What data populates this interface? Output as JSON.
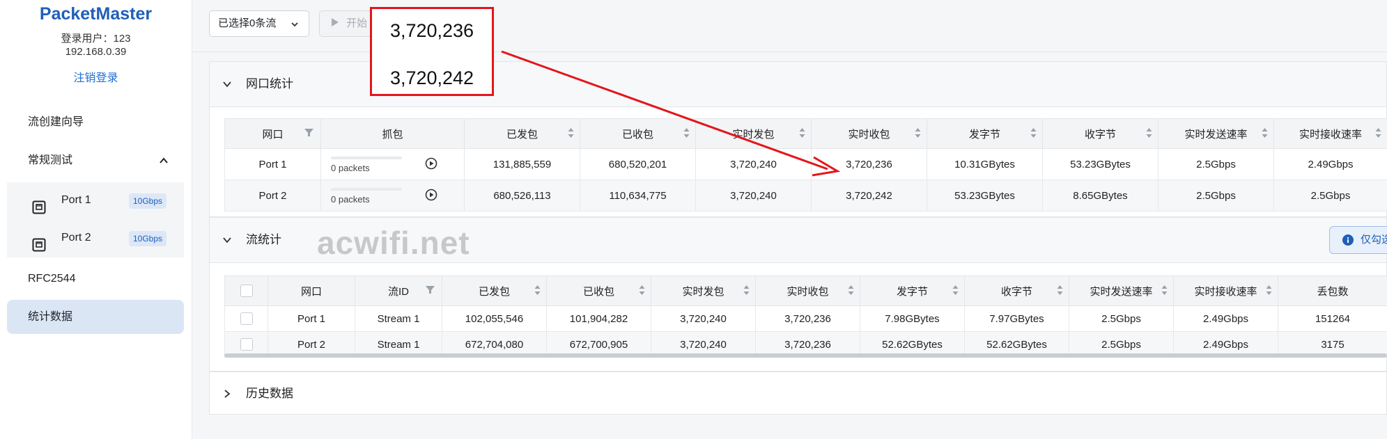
{
  "sidebar": {
    "brand": "PacketMaster",
    "login_user": "登录用户：123",
    "login_ip": "192.168.0.39",
    "logout": "注销登录",
    "nav": {
      "wizard": "流创建向导",
      "regular_test": "常规测试",
      "rfc": "RFC2544",
      "stats": "统计数据"
    },
    "ports": [
      {
        "label": "Port 1",
        "speed": "10Gbps"
      },
      {
        "label": "Port 2",
        "speed": "10Gbps"
      }
    ],
    "group_arrow": "^"
  },
  "toolbar": {
    "selected_flows": "已选择0条流",
    "start_label": "开始"
  },
  "annotation": {
    "value_top": "3,720,236",
    "value_bottom": "3,720,242",
    "color": "#e3161b"
  },
  "port_stats": {
    "title": "网口统计",
    "headers": [
      "网口",
      "抓包",
      "已发包",
      "已收包",
      "实时发包",
      "实时收包",
      "发字节",
      "收字节",
      "实时发送速率",
      "实时接收速率"
    ],
    "rows": [
      {
        "port": "Port 1",
        "capture": "0 packets",
        "tx": "131,885,559",
        "rx": "680,520,201",
        "rt_tx": "3,720,240",
        "rt_rx": "3,720,236",
        "tx_bytes": "10.31GBytes",
        "rx_bytes": "53.23GBytes",
        "tx_rate": "2.5Gbps",
        "rx_rate": "2.49Gbps"
      },
      {
        "port": "Port 2",
        "capture": "0 packets",
        "tx": "680,526,113",
        "rx": "110,634,775",
        "rt_tx": "3,720,240",
        "rt_rx": "3,720,242",
        "tx_bytes": "53.23GBytes",
        "rx_bytes": "8.65GBytes",
        "tx_rate": "2.5Gbps",
        "rx_rate": "2.5Gbps"
      }
    ]
  },
  "flow_stats": {
    "title": "流统计",
    "info_button": "仅勾选",
    "headers": [
      "网口",
      "流ID",
      "已发包",
      "已收包",
      "实时发包",
      "实时收包",
      "发字节",
      "收字节",
      "实时发送速率",
      "实时接收速率",
      "丢包数"
    ],
    "rows": [
      {
        "port": "Port 1",
        "flow": "Stream 1",
        "tx": "102,055,546",
        "rx": "101,904,282",
        "rt_tx": "3,720,240",
        "rt_rx": "3,720,236",
        "tx_bytes": "7.98GBytes",
        "rx_bytes": "7.97GBytes",
        "tx_rate": "2.5Gbps",
        "rx_rate": "2.49Gbps",
        "loss": "151264"
      },
      {
        "port": "Port 2",
        "flow": "Stream 1",
        "tx": "672,704,080",
        "rx": "672,700,905",
        "rt_tx": "3,720,240",
        "rt_rx": "3,720,236",
        "tx_bytes": "52.62GBytes",
        "rx_bytes": "52.62GBytes",
        "tx_rate": "2.5Gbps",
        "rx_rate": "2.49Gbps",
        "loss": "3175"
      }
    ]
  },
  "history": {
    "title": "历史数据"
  },
  "watermark": "acwifi.net"
}
